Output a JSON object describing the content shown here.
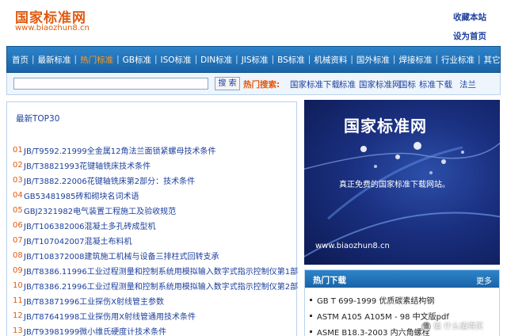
{
  "header": {
    "logo_title": "国家标准网",
    "logo_url": "www.biaozhun8.cn",
    "favorite_link": "收藏本站",
    "homepage_link": "设为首页"
  },
  "nav": {
    "items": [
      {
        "label": "首页",
        "active": false
      },
      {
        "label": "最新标准",
        "active": false
      },
      {
        "label": "热门标准",
        "active": true
      },
      {
        "label": "GB标准",
        "active": false
      },
      {
        "label": "ISO标准",
        "active": false
      },
      {
        "label": "DIN标准",
        "active": false
      },
      {
        "label": "JIS标准",
        "active": false
      },
      {
        "label": "BS标准",
        "active": false
      },
      {
        "label": "机械资料",
        "active": false
      },
      {
        "label": "国外标准",
        "active": false
      },
      {
        "label": "焊接标准",
        "active": false
      },
      {
        "label": "行业标准",
        "active": false
      },
      {
        "label": "其它",
        "active": false
      }
    ]
  },
  "search": {
    "input_value": "",
    "button_label": "搜 索",
    "hot_label": "热门搜索:",
    "keywords": [
      "国家标准下载",
      "标准",
      "国家标准网",
      "国标",
      "标准下载",
      "法兰"
    ]
  },
  "latest": {
    "title": "最新TOP30",
    "items": [
      {
        "num": "01",
        "text": "JB/T9592.21999全金属12角法兰面锁紧螺母技术条件"
      },
      {
        "num": "02",
        "text": "JB/T38821993花键轴铣床技术条件"
      },
      {
        "num": "03",
        "text": "JB/T3882.22006花键轴铣床第2部分：技术条件"
      },
      {
        "num": "04",
        "text": "GB53481985砖和砌块名词术语"
      },
      {
        "num": "05",
        "text": "GBJ2321982电气装置工程施工及验收规范"
      },
      {
        "num": "06",
        "text": "JB/T106382006混凝土多孔砖成型机"
      },
      {
        "num": "07",
        "text": "JB/T107042007混凝土布料机"
      },
      {
        "num": "08",
        "text": "JB/T108372008建筑施工机械与设备三排柱式回转支承"
      },
      {
        "num": "09",
        "text": "JB/T8386.11996工业过程测量和控制系统用模拟输入数字式指示控制仪第1部"
      },
      {
        "num": "10",
        "text": "JB/T8386.21996工业过程测量和控制系统用模拟输入数字式指示控制仪第2部"
      },
      {
        "num": "11",
        "text": "JB/T83871996工业探伤X射线管主参数"
      },
      {
        "num": "12",
        "text": "JB/T87641998工业探伤用X射线管通用技术条件"
      },
      {
        "num": "13",
        "text": "JB/T93981999微小维氏硬度计技术条件"
      }
    ]
  },
  "banner": {
    "title": "国家标准网",
    "slogan": "真正免费的国家标准下载网站。",
    "url": "www.biaozhun8.cn"
  },
  "hot_downloads": {
    "title": "热门下载",
    "more": "更多",
    "items": [
      "GB T 699-1999 优质碳素结构钢",
      "ASTM A105 A105M - 98 中文版pdf",
      "ASME B18.3-2003 内六角螺栓"
    ]
  },
  "watermark": {
    "text": "值 什么值得买"
  }
}
